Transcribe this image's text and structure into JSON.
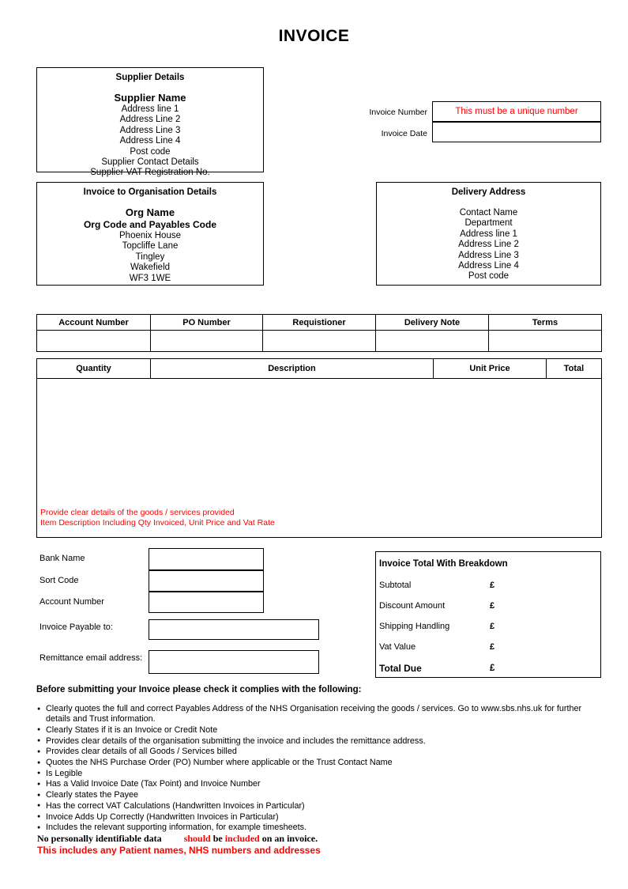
{
  "document": {
    "title": "INVOICE"
  },
  "supplier": {
    "heading": "Supplier Details",
    "name": "Supplier Name",
    "lines": [
      "Address line 1",
      "Address Line 2",
      "Address Line 3",
      "Address Line 4",
      "Post code",
      "Supplier Contact Details",
      "Supplier VAT Registration No."
    ]
  },
  "invoice_meta": {
    "number_label": "Invoice Number",
    "number_value": "This must be a unique number",
    "number_value_color": "#ff0000",
    "date_label": "Invoice Date",
    "date_value": ""
  },
  "organisation": {
    "heading": "Invoice to Organisation Details",
    "name": "Org Name",
    "code": "Org Code and Payables Code",
    "lines": [
      "Phoenix House",
      "Topcliffe Lane",
      "Tingley",
      "Wakefield",
      "WF3 1WE"
    ]
  },
  "delivery": {
    "heading": "Delivery Address",
    "lines": [
      "Contact Name",
      "Department",
      "Address line 1",
      "Address Line 2",
      "Address Line 3",
      "Address Line 4",
      "Post code"
    ]
  },
  "reference_table": {
    "headers": [
      "Account Number",
      "PO Number",
      "Requistioner",
      "Delivery Note",
      "Terms"
    ],
    "values": [
      "",
      "",
      "",
      "",
      ""
    ]
  },
  "items_table": {
    "headers": [
      "Quantity",
      "Description",
      "Unit Price",
      "Total"
    ],
    "rows": [],
    "note_lines": [
      "Provide clear details of the goods / services provided",
      "Item Description Including Qty Invoiced, Unit Price and Vat Rate"
    ],
    "note_color": "#ff0000"
  },
  "bank": {
    "fields": [
      {
        "label": "Bank Name",
        "value": ""
      },
      {
        "label": "Sort Code",
        "value": ""
      },
      {
        "label": "Account Number",
        "value": ""
      }
    ],
    "payable_label": "Invoice Payable to:",
    "payable_value": "",
    "remittance_label": "Remittance email address:",
    "remittance_value": ""
  },
  "totals": {
    "heading": "Invoice Total With Breakdown",
    "rows": [
      {
        "label": "Subtotal",
        "currency": "£",
        "value": ""
      },
      {
        "label": "Discount Amount",
        "currency": "£",
        "value": ""
      },
      {
        "label": "Shipping  Handling",
        "currency": "£",
        "value": ""
      },
      {
        "label": "Vat Value",
        "currency": "£",
        "value": ""
      }
    ],
    "total_label": "Total Due",
    "total_currency": "£",
    "total_value": ""
  },
  "checklist": {
    "heading": "Before submitting your Invoice please check it complies with the following:",
    "items": [
      "Clearly quotes the full and correct Payables Address of the NHS Organisation receiving the goods / services. Go to www.sbs.nhs.uk for further details and Trust information.",
      "Clearly States if it is an Invoice or Credit Note",
      "Provides clear details of the organisation submitting the invoice and includes the remittance address.",
      "Provides clear details of all Goods / Services billed",
      "Quotes the NHS Purchase Order (PO) Number where applicable or the Trust Contact Name",
      "Is Legible",
      "Has a Valid Invoice Date (Tax Point) and Invoice Number",
      "Clearly states the Payee",
      "Has the correct VAT Calculations (Handwritten Invoices in Particular)",
      "Invoice Adds Up Correctly (Handwritten Invoices in Particular)",
      "Includes the relevant supporting information, for example timesheets."
    ],
    "warning_line1_part1": "No personally identifiable data",
    "warning_line1_red1": "should",
    "warning_line1_part2": "be",
    "warning_line1_red2": "included",
    "warning_line1_part3": "on an invoice.",
    "warning_line2": "This includes any Patient names, NHS numbers and addresses"
  }
}
